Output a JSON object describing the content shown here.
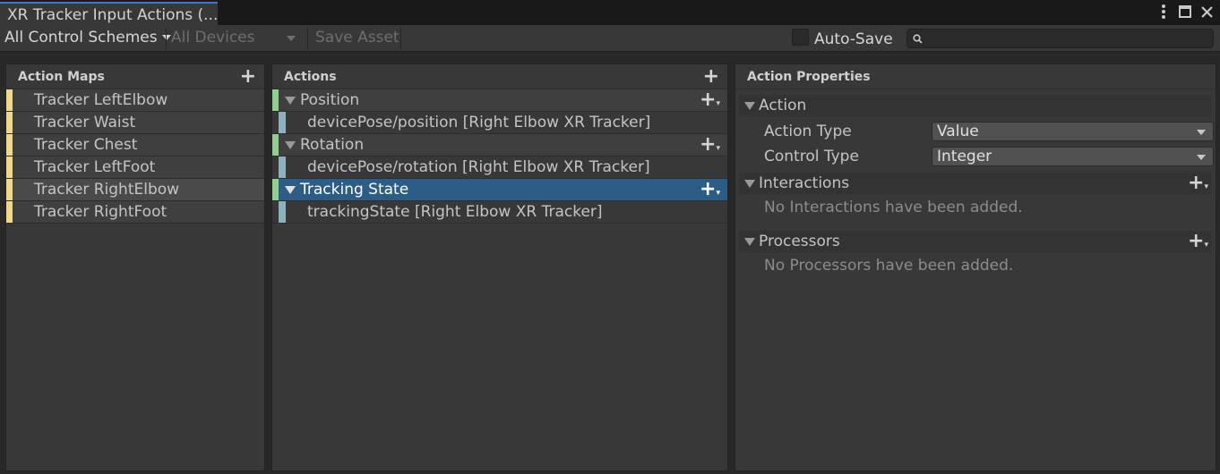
{
  "window": {
    "tab_title": "XR Tracker Input Actions (..."
  },
  "toolbar": {
    "control_schemes": "All Control Schemes",
    "devices": "All Devices",
    "save_asset": "Save Asset",
    "auto_save_label": "Auto-Save",
    "auto_save_checked": false,
    "search_value": ""
  },
  "action_maps": {
    "header": "Action Maps",
    "items": [
      {
        "label": "Tracker LeftElbow"
      },
      {
        "label": "Tracker Waist"
      },
      {
        "label": "Tracker Chest"
      },
      {
        "label": "Tracker LeftFoot"
      },
      {
        "label": "Tracker RightElbow",
        "selected": true
      },
      {
        "label": "Tracker RightFoot"
      }
    ]
  },
  "actions": {
    "header": "Actions",
    "items": [
      {
        "label": "Position",
        "binding": "devicePose/position [Right Elbow XR Tracker]"
      },
      {
        "label": "Rotation",
        "binding": "devicePose/rotation [Right Elbow XR Tracker]"
      },
      {
        "label": "Tracking State",
        "binding": "trackingState [Right Elbow XR Tracker]",
        "selected": true
      }
    ]
  },
  "properties": {
    "header": "Action Properties",
    "action_section": "Action",
    "action_type_label": "Action Type",
    "action_type_value": "Value",
    "control_type_label": "Control Type",
    "control_type_value": "Integer",
    "interactions_section": "Interactions",
    "interactions_empty": "No Interactions have been added.",
    "processors_section": "Processors",
    "processors_empty": "No Processors have been added."
  },
  "colors": {
    "accent": "#3a79bb",
    "selected_row": "#2c5d87",
    "map_stripe": "#f1d886",
    "action_stripe": "#8fcf8f",
    "binding_stripe": "#8cb2be"
  }
}
